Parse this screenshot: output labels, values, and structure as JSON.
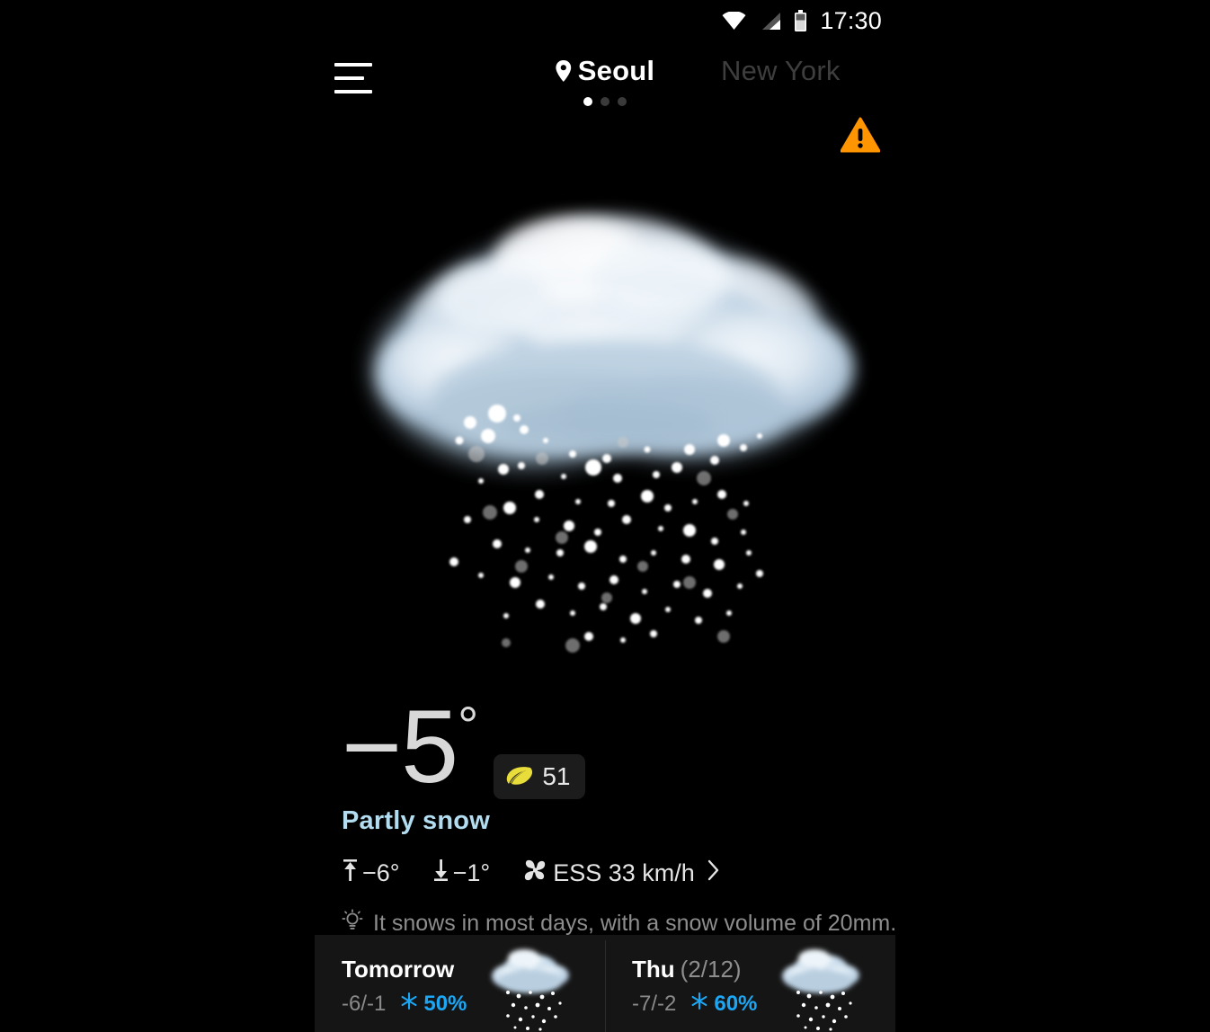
{
  "status_bar": {
    "time": "17:30",
    "icons": [
      "wifi-icon",
      "cellular-signal-icon",
      "battery-icon"
    ]
  },
  "header": {
    "menu_icon": "hamburger-menu-icon",
    "active_city": "Seoul",
    "location_icon": "location-pin-icon",
    "next_city": "New York",
    "alert_icon": "warning-triangle-icon",
    "alert_color": "#FF9500",
    "page_dots": {
      "count": 3,
      "active_index": 0
    }
  },
  "current": {
    "weather_icon": "snow-cloud-icon",
    "temperature": "−5",
    "degree": "°",
    "aqi_icon": "leaf-icon",
    "aqi_color": "#E8DD3A",
    "aqi_value": "51",
    "condition": "Partly snow",
    "condition_color": "#b2dcf0",
    "high_icon": "arrow-up-icon",
    "high_temp": "−6°",
    "low_icon": "arrow-down-icon",
    "low_temp": "−1°",
    "wind_icon": "pinwheel-icon",
    "wind": "ESS 33 km/h",
    "chevron_icon": "chevron-right-icon",
    "tip_icon": "lightbulb-icon",
    "tip_text": "It snows in most days, with a snow volume of 20mm."
  },
  "forecast": [
    {
      "day": "Tomorrow",
      "date": "",
      "range": "-6/-1",
      "precip_icon": "snowflake-icon",
      "precip": "50%",
      "precip_color": "#1ca7f5",
      "icon": "snow-cloud-icon"
    },
    {
      "day": "Thu",
      "date": "(2/12)",
      "range": "-7/-2",
      "precip_icon": "snowflake-icon",
      "precip": "60%",
      "precip_color": "#1ca7f5",
      "icon": "snow-cloud-icon"
    }
  ]
}
